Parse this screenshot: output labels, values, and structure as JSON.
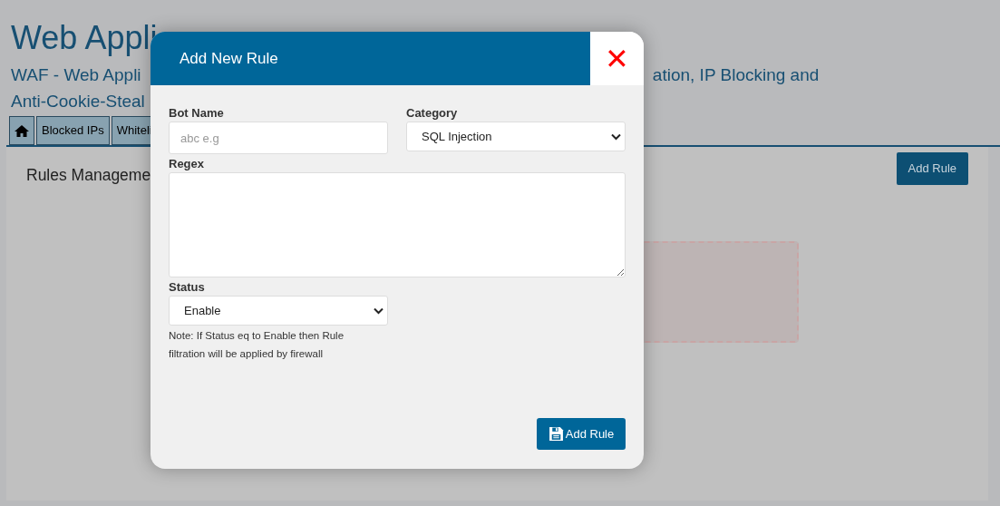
{
  "page": {
    "title": "Web Appli",
    "subtitle_lines": [
      "WAF - Web Appli",
      "Anti-Cookie-Steal"
    ],
    "subtitle_right": "ation, IP Blocking and",
    "tabs": [
      {
        "kind": "home"
      },
      {
        "kind": "text",
        "label": "Blocked IPs"
      },
      {
        "kind": "text",
        "label": "Whiteli"
      }
    ],
    "section_title": "Rules Manageme",
    "add_button": "Add Rule"
  },
  "modal": {
    "title": "Add New Rule",
    "close": "✕",
    "fields": {
      "bot_name": {
        "label": "Bot Name",
        "placeholder": "abc e.g"
      },
      "category": {
        "label": "Category",
        "value": "SQL Injection"
      },
      "regex": {
        "label": "Regex"
      },
      "status": {
        "label": "Status",
        "value": "Enable"
      }
    },
    "note": "Note: If Status eq to Enable then Rule filtration will be applied by firewall",
    "submit": "Add Rule"
  }
}
